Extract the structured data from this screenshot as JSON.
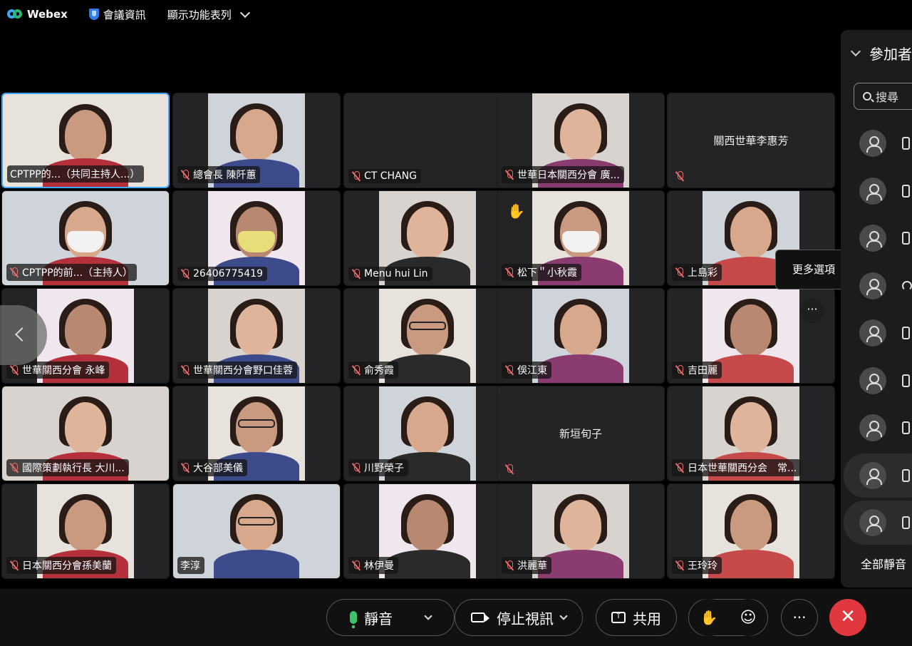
{
  "app": {
    "name": "Webex",
    "meeting_info": "會議資訊",
    "show_menu": "顯示功能表列"
  },
  "tiles": [
    {
      "name": "CPTPP的...（共同主持人...）",
      "video": true
    },
    {
      "name": "總會長 陳阡蕙",
      "video": true
    },
    {
      "name": "CT CHANG",
      "video": false
    },
    {
      "name": "世華日本關西分會 廣...",
      "video": true
    },
    {
      "name": "",
      "center": "關西世華李惠芳",
      "video": false
    },
    {
      "name": "CPTPP的前...（主持人）",
      "video": true
    },
    {
      "name": "26406775419",
      "video": true
    },
    {
      "name": "Menu hui Lin",
      "video": true
    },
    {
      "name": "松下＂小秋霞",
      "video": true,
      "hand": "✋"
    },
    {
      "name": "上島彩",
      "video": true
    },
    {
      "name": "世華關西分會 永峰",
      "video": true
    },
    {
      "name": "世華關西分會野口佳蓉",
      "video": true
    },
    {
      "name": "俞秀霞",
      "video": true
    },
    {
      "name": "俁江東",
      "video": true
    },
    {
      "name": "吉田麗",
      "video": true
    },
    {
      "name": "國際策劃執行長 大川...",
      "video": true
    },
    {
      "name": "大谷部美儀",
      "video": true
    },
    {
      "name": "川野榮子",
      "video": true
    },
    {
      "name": "",
      "center": "新垣旬子",
      "video": false
    },
    {
      "name": "日本世華關西分会　常...",
      "video": true
    },
    {
      "name": "日本關西分會孫美蘭",
      "video": true
    },
    {
      "name": "李淳",
      "video": true
    },
    {
      "name": "林伊曼",
      "video": true
    },
    {
      "name": "洪麗華",
      "video": true
    },
    {
      "name": "王玲玲",
      "video": true
    }
  ],
  "tooltip": "更多選項",
  "tile_more": "···",
  "panel": {
    "title": "參加者",
    "search_placeholder": "搜尋",
    "mute_all": "全部靜音"
  },
  "toolbar": {
    "mute": "靜音",
    "stop_video": "停止視訊",
    "share": "共用",
    "more": "···",
    "leave": "✕"
  }
}
